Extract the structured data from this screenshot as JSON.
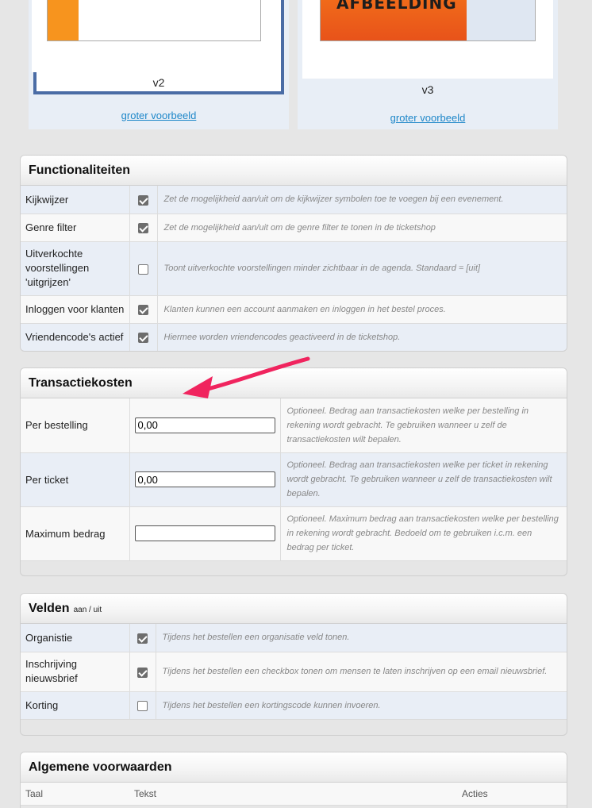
{
  "preview": {
    "items": [
      {
        "caption": "v2",
        "link": "groter voorbeeld"
      },
      {
        "caption": "v3",
        "link": "groter voorbeeld",
        "banner_text": "AFBEELDING"
      }
    ]
  },
  "functionaliteiten": {
    "title": "Functionaliteiten",
    "rows": [
      {
        "label": "Kijkwijzer",
        "checked": true,
        "desc": "Zet de mogelijkheid aan/uit om de kijkwijzer symbolen toe te voegen bij een evenement."
      },
      {
        "label": "Genre filter",
        "checked": true,
        "desc": "Zet de mogelijkheid aan/uit om de genre filter te tonen in de ticketshop"
      },
      {
        "label": "Uitverkochte voorstellingen 'uitgrijzen'",
        "checked": false,
        "desc": "Toont uitverkochte voorstellingen minder zichtbaar in de agenda. Standaard = [uit]"
      },
      {
        "label": "Inloggen voor klanten",
        "checked": true,
        "desc": "Klanten kunnen een account aanmaken en inloggen in het bestel proces."
      },
      {
        "label": "Vriendencode's actief",
        "checked": true,
        "desc": "Hiermee worden vriendencodes geactiveerd in de ticketshop."
      }
    ]
  },
  "transactiekosten": {
    "title": "Transactiekosten",
    "rows": [
      {
        "label": "Per bestelling",
        "value": "0,00",
        "desc": "Optioneel. Bedrag aan transactiekosten welke per bestelling in rekening wordt gebracht. Te gebruiken wanneer u zelf de transactiekosten wilt bepalen."
      },
      {
        "label": "Per ticket",
        "value": "0,00",
        "desc": "Optioneel. Bedrag aan transactiekosten welke per ticket in rekening wordt gebracht. Te gebruiken wanneer u zelf de transactiekosten wilt bepalen."
      },
      {
        "label": "Maximum bedrag",
        "value": "",
        "desc": "Optioneel. Maximum bedrag aan transactiekosten welke per bestelling in rekening wordt gebracht. Bedoeld om te gebruiken i.c.m. een bedrag per ticket."
      }
    ]
  },
  "velden": {
    "title": "Velden",
    "subtitle": "aan / uit",
    "rows": [
      {
        "label": "Organistie",
        "checked": true,
        "desc": "Tijdens het bestellen een organisatie veld tonen."
      },
      {
        "label": "Inschrijving nieuwsbrief",
        "checked": true,
        "desc": "Tijdens het bestellen een checkbox tonen om mensen te laten inschrijven op een email nieuwsbrief."
      },
      {
        "label": "Korting",
        "checked": false,
        "desc": "Tijdens het bestellen een kortingscode kunnen invoeren."
      }
    ]
  },
  "voorwaarden": {
    "title": "Algemene voorwaarden",
    "columns": [
      "Taal",
      "Tekst",
      "Acties"
    ]
  },
  "colors": {
    "accent_arrow": "#f0245e",
    "link": "#1e87c9",
    "selected_frame": "#4a6ca5"
  }
}
